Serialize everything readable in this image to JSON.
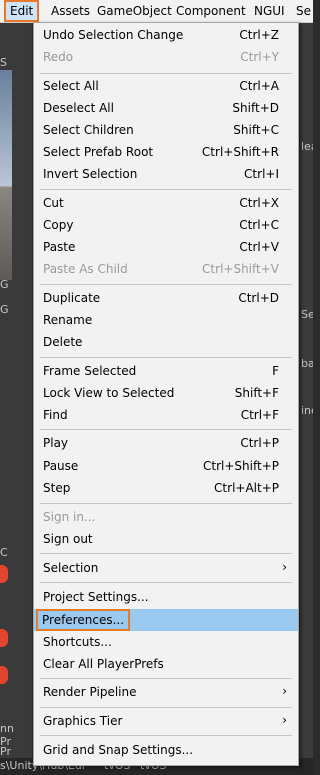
{
  "menubar": {
    "items": [
      "Edit",
      "Assets",
      "GameObject",
      "Component",
      "NGUI",
      "Se"
    ],
    "active": "Edit"
  },
  "background": {
    "left_fragments": [
      "S",
      "G",
      "G",
      "C",
      "Pr",
      "nn",
      "Pr"
    ],
    "right_fragments": [
      "lea",
      "Se",
      "ba",
      "ine"
    ],
    "bottom_left": "s\\Unity\\Hub\\Edi",
    "bottom_tabs": [
      "tvOS",
      "tvOS"
    ]
  },
  "menu": {
    "groups": [
      [
        {
          "label": "Undo Selection Change",
          "shortcut": "Ctrl+Z",
          "disabled": false
        },
        {
          "label": "Redo",
          "shortcut": "Ctrl+Y",
          "disabled": true
        }
      ],
      [
        {
          "label": "Select All",
          "shortcut": "Ctrl+A",
          "disabled": false
        },
        {
          "label": "Deselect All",
          "shortcut": "Shift+D",
          "disabled": false
        },
        {
          "label": "Select Children",
          "shortcut": "Shift+C",
          "disabled": false
        },
        {
          "label": "Select Prefab Root",
          "shortcut": "Ctrl+Shift+R",
          "disabled": false
        },
        {
          "label": "Invert Selection",
          "shortcut": "Ctrl+I",
          "disabled": false
        }
      ],
      [
        {
          "label": "Cut",
          "shortcut": "Ctrl+X",
          "disabled": false
        },
        {
          "label": "Copy",
          "shortcut": "Ctrl+C",
          "disabled": false
        },
        {
          "label": "Paste",
          "shortcut": "Ctrl+V",
          "disabled": false
        },
        {
          "label": "Paste As Child",
          "shortcut": "Ctrl+Shift+V",
          "disabled": true
        }
      ],
      [
        {
          "label": "Duplicate",
          "shortcut": "Ctrl+D",
          "disabled": false
        },
        {
          "label": "Rename",
          "shortcut": "",
          "disabled": false
        },
        {
          "label": "Delete",
          "shortcut": "",
          "disabled": false
        }
      ],
      [
        {
          "label": "Frame Selected",
          "shortcut": "F",
          "disabled": false
        },
        {
          "label": "Lock View to Selected",
          "shortcut": "Shift+F",
          "disabled": false
        },
        {
          "label": "Find",
          "shortcut": "Ctrl+F",
          "disabled": false
        }
      ],
      [
        {
          "label": "Play",
          "shortcut": "Ctrl+P",
          "disabled": false
        },
        {
          "label": "Pause",
          "shortcut": "Ctrl+Shift+P",
          "disabled": false
        },
        {
          "label": "Step",
          "shortcut": "Ctrl+Alt+P",
          "disabled": false
        }
      ],
      [
        {
          "label": "Sign in...",
          "shortcut": "",
          "disabled": true
        },
        {
          "label": "Sign out",
          "shortcut": "",
          "disabled": false
        }
      ],
      [
        {
          "label": "Selection",
          "shortcut": "",
          "disabled": false,
          "submenu": true
        }
      ],
      [
        {
          "label": "Project Settings...",
          "shortcut": "",
          "disabled": false
        },
        {
          "label": "Preferences...",
          "shortcut": "",
          "disabled": false,
          "highlighted": true
        },
        {
          "label": "Shortcuts...",
          "shortcut": "",
          "disabled": false
        },
        {
          "label": "Clear All PlayerPrefs",
          "shortcut": "",
          "disabled": false
        }
      ],
      [
        {
          "label": "Render Pipeline",
          "shortcut": "",
          "disabled": false,
          "submenu": true
        }
      ],
      [
        {
          "label": "Graphics Tier",
          "shortcut": "",
          "disabled": false,
          "submenu": true
        }
      ],
      [
        {
          "label": "Grid and Snap Settings...",
          "shortcut": "",
          "disabled": false
        }
      ]
    ]
  },
  "icons": {
    "submenu_arrow": "chevron-right-icon"
  },
  "colors": {
    "highlight": "#99c9ef",
    "annotation": "#e8782a",
    "menu_bg": "#f2f2f2"
  }
}
